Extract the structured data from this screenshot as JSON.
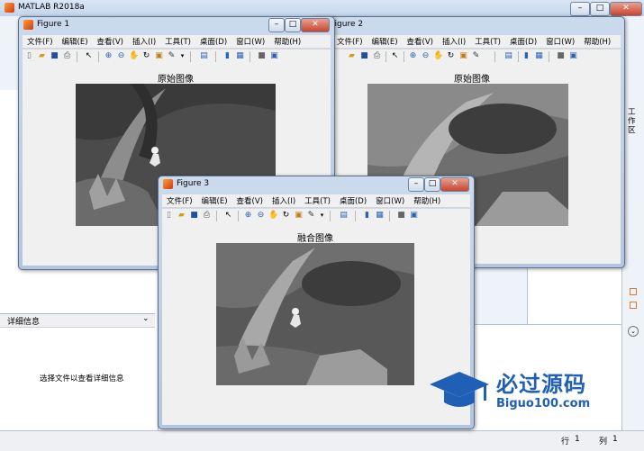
{
  "app": {
    "title": "MATLAB R2018a",
    "left_panel_header": "详细信息",
    "left_panel_message": "选择文件以查看详细信息",
    "right_tab_label": "工作区",
    "status": {
      "row_label": "行",
      "row_value": "1",
      "col_label": "列",
      "col_value": "1"
    }
  },
  "menu": [
    "文件(F)",
    "编辑(E)",
    "查看(V)",
    "插入(I)",
    "工具(T)",
    "桌面(D)",
    "窗口(W)",
    "帮助(H)"
  ],
  "figures": {
    "fig1": {
      "title": "Figure 1",
      "axes_title": "原始图像"
    },
    "fig2": {
      "title": "Figure 2",
      "axes_title": "原始图像"
    },
    "fig3": {
      "title": "Figure 3",
      "axes_title": "融合图像"
    }
  },
  "watermark": {
    "brand": "必过源码",
    "url": "Biguo100.com"
  },
  "colors": {
    "window_frame": "#b2c6df",
    "watermark_blue": "#1f5fb5"
  }
}
